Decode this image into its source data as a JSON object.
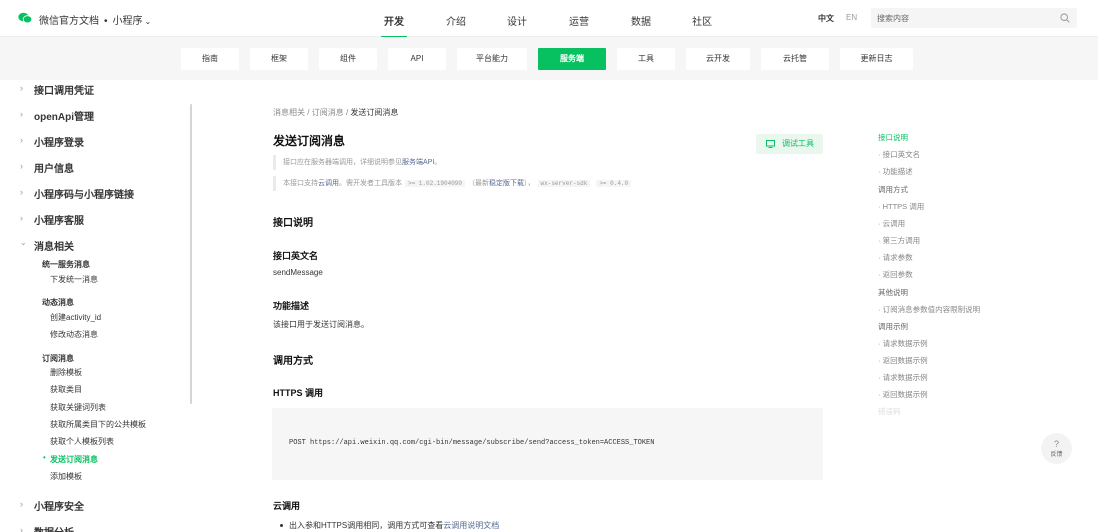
{
  "header": {
    "brand": "微信官方文档",
    "product": "小程序",
    "nav": [
      "开发",
      "介绍",
      "设计",
      "运营",
      "数据",
      "社区"
    ],
    "active_nav": "开发",
    "lang_zh": "中文",
    "lang_en": "EN",
    "search_placeholder": "搜索内容"
  },
  "subnav": [
    "指南",
    "框架",
    "组件",
    "API",
    "平台能力",
    "服务端",
    "工具",
    "云开发",
    "云托管",
    "更新日志"
  ],
  "sidebar": {
    "top_items": [
      "接口调用凭证",
      "openApi管理",
      "小程序登录",
      "用户信息",
      "小程序码与小程序链接",
      "小程序客服"
    ],
    "expanded": "消息相关",
    "groups": [
      {
        "title": "统一服务消息",
        "items": [
          "下发统一消息"
        ]
      },
      {
        "title": "动态消息",
        "items": [
          "创建activity_id",
          "修改动态消息"
        ]
      },
      {
        "title": "订阅消息",
        "items": [
          "删除模板",
          "获取类目",
          "获取关键词列表",
          "获取所属类目下的公共模板",
          "获取个人模板列表",
          "发送订阅消息",
          "添加模板"
        ]
      }
    ],
    "bottom_items": [
      "小程序安全",
      "数据分析"
    ]
  },
  "breadcrumb": {
    "a": "消息相关",
    "b": "订阅消息",
    "current": "发送订阅消息",
    "sep": "/"
  },
  "doc": {
    "title": "发送订阅消息",
    "debug_btn": "调试工具",
    "note1_pre": "接口应在服务器端调用，详细说明参见",
    "note1_link": "服务端API",
    "note1_post": "。",
    "note2_pre": "本接口支持",
    "note2_link1": "云调用",
    "note2_mid": "。需开发者工具版本",
    "note2_code1": ">= 1.02.1904090",
    "note2_mid2": "（最新",
    "note2_link2": "稳定版下载",
    "note2_mid3": "），",
    "note2_code2": "wx-server-sdk",
    "note2_code3": ">= 0.4.0",
    "sec_api": "接口说明",
    "sec_en_name": "接口英文名",
    "en_name": "sendMessage",
    "sec_desc": "功能描述",
    "desc": "该接口用于发送订阅消息。",
    "sec_call": "调用方式",
    "sec_https": "HTTPS 调用",
    "code": "POST https://api.weixin.qq.com/cgi-bin/message/subscribe/send?access_token=ACCESS_TOKEN",
    "sec_cloud": "云调用",
    "bullet_pre": "出入参和HTTPS调用相同，调用方式可查看",
    "bullet_link": "云调用说明文档"
  },
  "toc": [
    {
      "label": "接口说明",
      "level": 1,
      "active": true
    },
    {
      "label": "· 接口英文名",
      "level": 2
    },
    {
      "label": "· 功能描述",
      "level": 2
    },
    {
      "label": "调用方式",
      "level": 1
    },
    {
      "label": "· HTTPS 调用",
      "level": 2
    },
    {
      "label": "· 云调用",
      "level": 2
    },
    {
      "label": "· 第三方调用",
      "level": 2
    },
    {
      "label": "· 请求参数",
      "level": 2
    },
    {
      "label": "· 返回参数",
      "level": 2
    },
    {
      "label": "其他说明",
      "level": 1
    },
    {
      "label": "· 订阅消息参数值内容限制说明",
      "level": 2
    },
    {
      "label": "调用示例",
      "level": 1
    },
    {
      "label": "· 请求数据示例",
      "level": 2
    },
    {
      "label": "· 返回数据示例",
      "level": 2
    },
    {
      "label": "· 请求数据示例",
      "level": 2
    },
    {
      "label": "· 返回数据示例",
      "level": 2
    },
    {
      "label": "错误码",
      "level": 1,
      "fade": true
    }
  ],
  "feedback": {
    "q": "?",
    "label": "反馈"
  },
  "colors": {
    "accent": "#07c160",
    "link": "#576b95"
  }
}
